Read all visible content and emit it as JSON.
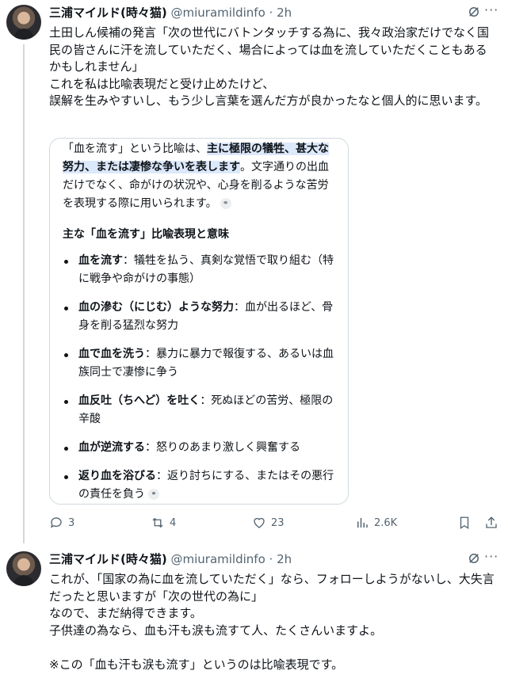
{
  "tweet1": {
    "name": "三浦マイルド(時々猫)",
    "handle": "@miuramildinfo",
    "time": "· 2h",
    "text": "土田しん候補の発言「次の世代にバトンタッチする為に、我々政治家だけでなく国民の皆さんに汗を流していただく、場合によっては血を流していただくこともあるかもしれません」\nこれを私は比喩表現だと受け止めたけど、\n誤解を生みやすいし、もう少し言葉を選んだ方が良かったなと個人的に思います。",
    "card": {
      "intro_prefix": "「血を流す」という比喩は、",
      "intro_highlight": "主に極限の犠牲、甚大な努力、または凄惨な争いを表します",
      "intro_suffix": "。文字通りの出血だけでなく、命がけの状況や、心身を削るような苦労を表現する際に用いられます。",
      "heading": "主な「血を流す」比喩表現と意味",
      "items": [
        {
          "term": "血を流す",
          "desc": "：犠牲を払う、真剣な覚悟で取り組む（特に戦争や命がけの事態）"
        },
        {
          "term": "血の滲む（にじむ）ような努力",
          "desc": "：血が出るほど、骨身を削る猛烈な努力"
        },
        {
          "term": "血で血を洗う",
          "desc": "：暴力に暴力で報復する、あるいは血族同士で凄惨に争う"
        },
        {
          "term": "血反吐（ちへど）を吐く",
          "desc": "：死ぬほどの苦労、極限の辛酸"
        },
        {
          "term": "血が逆流する",
          "desc": "：怒りのあまり激しく興奮する"
        },
        {
          "term": "返り血を浴びる",
          "desc": "：返り討ちにする、またはその悪行の責任を負う"
        }
      ]
    },
    "actions": {
      "replies": "3",
      "reposts": "4",
      "likes": "23",
      "views": "2.6K"
    }
  },
  "tweet2": {
    "name": "三浦マイルド(時々猫)",
    "handle": "@miuramildinfo",
    "time": "· 2h",
    "text": "これが、「国家の為に血を流していただく」なら、フォローしようがないし、大失言だったと思いますが「次の世代の為に」\nなので、まだ納得できます。\n子供達の為なら、血も汗も涙も流すて人、たくさんいますよ。\n\n※この「血も汗も涙も流す」というのは比喩表現です。"
  },
  "colors": {
    "text": "#0f1419",
    "muted": "#536471",
    "border": "#cfd9de",
    "highlight": "#dce8fb"
  },
  "icons": [
    "grok-icon",
    "more-icon",
    "reply-icon",
    "repost-icon",
    "like-icon",
    "views-icon",
    "bookmark-icon",
    "share-icon",
    "link-icon"
  ]
}
